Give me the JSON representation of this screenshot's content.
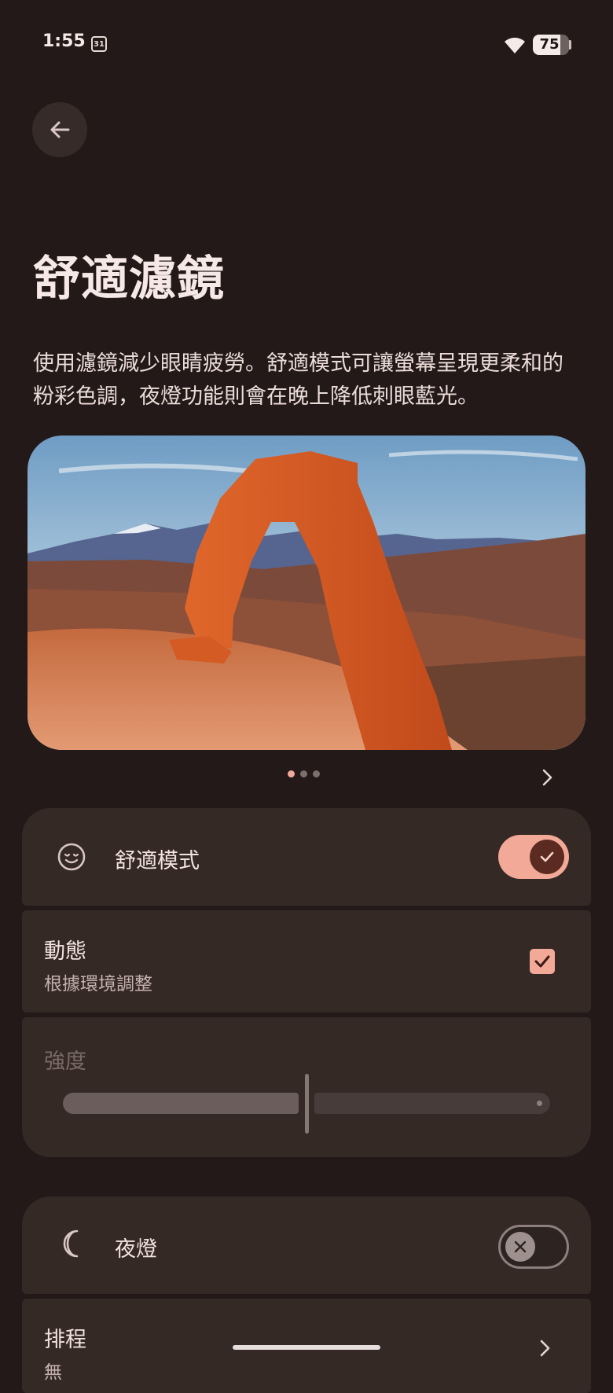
{
  "status_bar": {
    "time": "1:55",
    "calendar_day": "31",
    "battery_level": "75"
  },
  "page": {
    "title": "舒適濾鏡",
    "description": "使用濾鏡減少眼睛疲勞。舒適模式可讓螢幕呈現更柔和的粉彩色調，夜燈功能則會在晚上降低刺眼藍光。"
  },
  "carousel": {
    "page_count": 3,
    "active_index": 0
  },
  "comfort_mode": {
    "label": "舒適模式",
    "enabled": true
  },
  "dynamic": {
    "label": "動態",
    "subtitle": "根據環境調整",
    "checked": true
  },
  "intensity": {
    "label": "強度",
    "value": 0.5
  },
  "night_light": {
    "label": "夜燈",
    "enabled": false
  },
  "schedule": {
    "label": "排程",
    "subtitle": "無"
  },
  "colors": {
    "accent": "#f3a997",
    "background": "#221918",
    "card": "#352926"
  }
}
